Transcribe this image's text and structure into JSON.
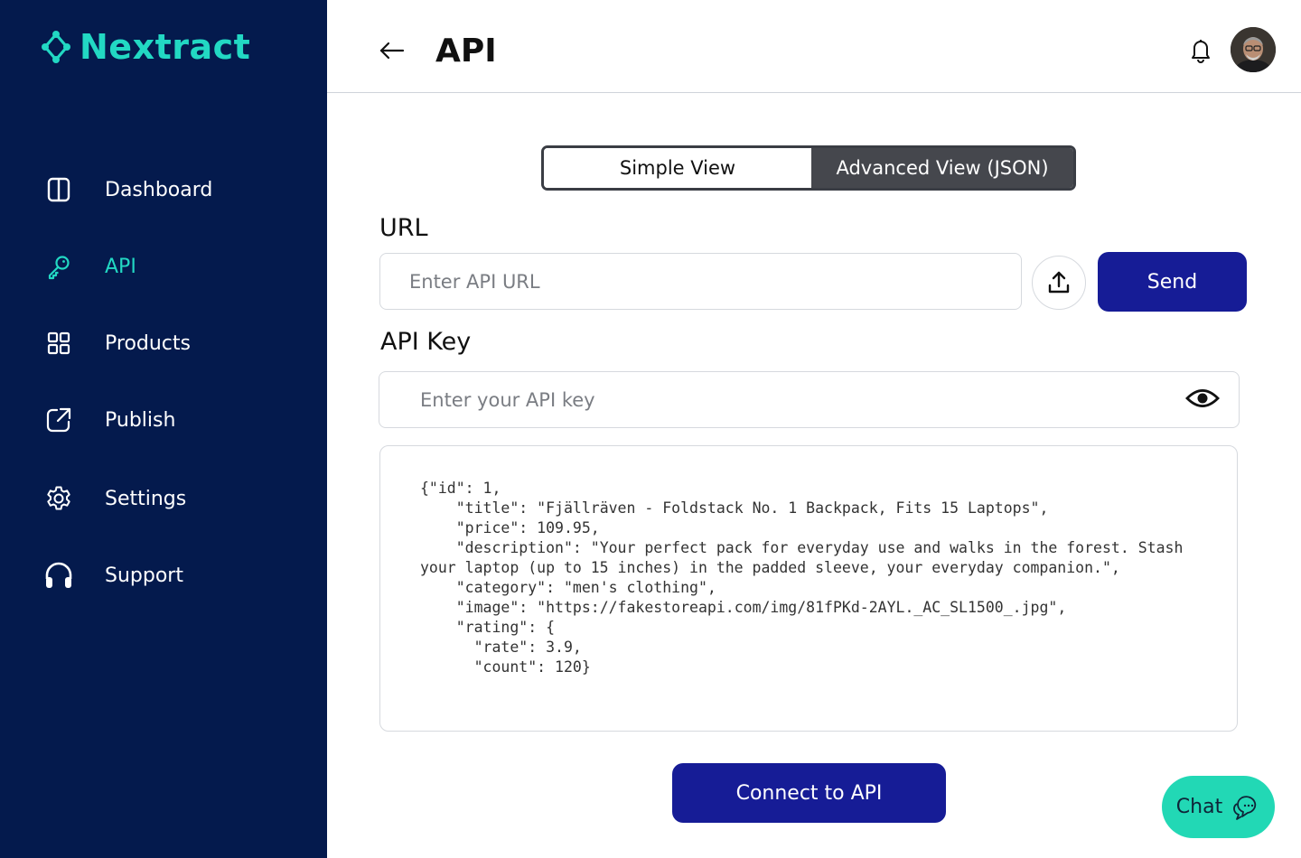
{
  "brand": {
    "name": "Nextract",
    "accent_color": "#22d8c3",
    "sidebar_color": "#041a4d"
  },
  "sidebar": {
    "items": [
      {
        "label": "Dashboard",
        "icon": "dashboard-icon",
        "active": false
      },
      {
        "label": "API",
        "icon": "key-icon",
        "active": true
      },
      {
        "label": "Products",
        "icon": "grid-icon",
        "active": false
      },
      {
        "label": "Publish",
        "icon": "external-link-icon",
        "active": false
      },
      {
        "label": "Settings",
        "icon": "gear-icon",
        "active": false
      },
      {
        "label": "Support",
        "icon": "headphones-icon",
        "active": false
      }
    ]
  },
  "header": {
    "title": "API",
    "back_icon": "arrow-left-icon",
    "notification_icon": "bell-icon",
    "avatar": "user-avatar"
  },
  "view_toggle": {
    "options": [
      "Simple View",
      "Advanced View (JSON)"
    ],
    "selected": "Advanced View (JSON)"
  },
  "url_section": {
    "label": "URL",
    "placeholder": "Enter API URL",
    "value": "",
    "upload_icon": "upload-icon",
    "send_label": "Send"
  },
  "api_key_section": {
    "label": "API Key",
    "placeholder": "Enter your API key",
    "value": "",
    "visibility_icon": "eye-icon"
  },
  "json_preview": "{\"id\": 1,\n    \"title\": \"Fjällräven - Foldstack No. 1 Backpack, Fits 15 Laptops\",\n    \"price\": 109.95,\n    \"description\": \"Your perfect pack for everyday use and walks in the forest. Stash your laptop (up to 15 inches) in the padded sleeve, your everyday companion.\",\n    \"category\": \"men's clothing\",\n    \"image\": \"https://fakestoreapi.com/img/81fPKd-2AYL._AC_SL1500_.jpg\",\n    \"rating\": {\n      \"rate\": 3.9,\n      \"count\": 120}",
  "connect_button": {
    "label": "Connect to API",
    "color": "#161c96"
  },
  "chat_button": {
    "label": "Chat",
    "icon": "chat-bubble-icon",
    "color": "#22d8b5"
  }
}
